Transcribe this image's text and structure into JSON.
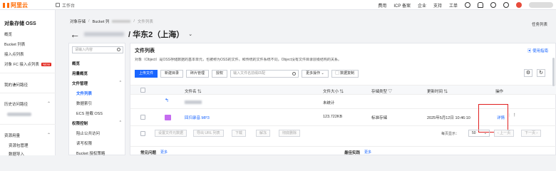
{
  "topbar": {
    "logo_text": "阿里云",
    "workspace": "工作台",
    "nav": [
      "费用",
      "ICP 备案",
      "企业",
      "支持",
      "工单"
    ]
  },
  "sidebar": {
    "title": "对象存储 OSS",
    "items": [
      "概览",
      "Bucket 列表",
      "接入点列表",
      "对象 FC 接入点列表"
    ],
    "new_badge": "NEW",
    "my_access": "我的访问路径",
    "recent": "历史访问路径",
    "resources": "资源用量",
    "res_items": [
      "资源包管理",
      "数据导入"
    ]
  },
  "breadcrumb": {
    "root": "对象存储",
    "bucket": "Bucket 列",
    "current": "文件列表"
  },
  "header": {
    "title": "/ 华东2（上海）",
    "task_list": "任务列表"
  },
  "leftnav": {
    "search_placeholder": "请输入内容",
    "overview": "概览",
    "user_usage": "用量概览",
    "file_mgmt": "文件管理",
    "file_list": "文件列表",
    "data_index": "数据索引",
    "ecs_mount": "ECS 挂载 OSS",
    "perm": "权限控制",
    "block_public": "阻止公共访问",
    "rw_perm": "读写权限",
    "bucket_policy": "Bucket 授权策略"
  },
  "main": {
    "section_title": "文件列表",
    "usage_link": "使用指南",
    "description": "对象（Object）是OSS存储数据的基本单元，也被称为OSS的文件。和传统的文件系统不同，Object没有文件目录层级结构的关系。",
    "toolbar": {
      "upload": "上传文件",
      "new_dir": "新建目录",
      "fragments": "碎片管理",
      "authorize": "授权",
      "search_placeholder": "输入文件名前缀匹配",
      "more": "更多操作",
      "export": "数据复制"
    },
    "columns": [
      "文件名",
      "文件大小",
      "存储类型",
      "更新时间",
      "操作"
    ],
    "rows": [
      {
        "name": "",
        "size": "未统计",
        "type": "",
        "time": "",
        "action": ""
      },
      {
        "name": "回归录音.MP3",
        "size": "123.722KB",
        "type": "标准存储",
        "time": "2025年5月12日 10:46:10",
        "action": "详情"
      }
    ],
    "batch": [
      "设置文件元数据",
      "导出 URL 列表",
      "下载",
      "解冻",
      "彻底删除"
    ],
    "pager": {
      "per_page_label": "每页显示：",
      "per_page_value": "50",
      "prev": "上一页",
      "next": "下一页"
    },
    "faq": {
      "common": "常见问题",
      "more1": "更多",
      "best": "最佳实践",
      "more2": "更多"
    }
  }
}
